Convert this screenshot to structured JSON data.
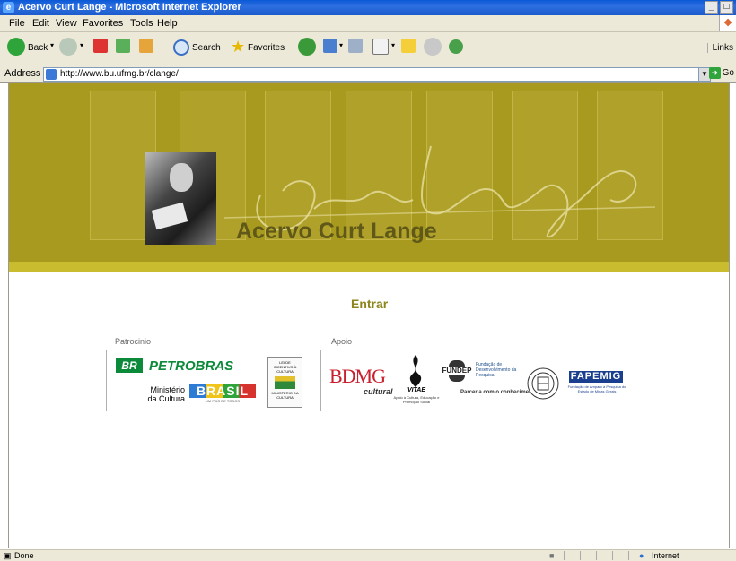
{
  "window": {
    "title": "Acervo Curt Lange - Microsoft Internet Explorer",
    "minimize": "_",
    "maximize": "□"
  },
  "menu": [
    "File",
    "Edit",
    "View",
    "Favorites",
    "Tools",
    "Help"
  ],
  "toolbar": {
    "back": "Back",
    "search": "Search",
    "favorites": "Favorites",
    "links": "Links"
  },
  "address": {
    "label": "Address",
    "url": "http://www.bu.ufmg.br/clange/",
    "go": "Go"
  },
  "page": {
    "banner_title": "Acervo Curt Lange",
    "enter_link": "Entrar",
    "sponsor_label": "Patrocinio",
    "support_label": "Apoio",
    "sponsors": {
      "petrobras": "PETROBRAS",
      "br": "BR",
      "ministerio": "Ministério\nda Cultura",
      "brasil": "BRASIL",
      "brasil_tag": "UM PAÍS DE TODOS",
      "lei": "LEI DE INCENTIVO À CULTURA",
      "lei_min": "MINISTÉRIO DA CULTURA"
    },
    "supporters": {
      "bdmg": "BDMG",
      "bdmg_sub": "cultural",
      "vitae": "VITAE",
      "vitae_sub": "Apoio à Cultura, Educação e Promoção Social",
      "fundep": "FUNDEP",
      "fundep_text": "Fundação de Desenvolvimento da Pesquisa",
      "fundep_tag": "Parceria com o conhecimento.",
      "fapemig": "FAPEMIG",
      "fapemig_sub": "Fundação de Amparo à Pesquisa do Estado de Minas Gerais"
    }
  },
  "status": {
    "text": "Done",
    "zone": "Internet"
  },
  "colors": {
    "banner": "#a79a1e",
    "banner_stripe": "#c9bc2e",
    "title": "#5f5818",
    "link": "#8d851b",
    "petrobras_green": "#0b8a3a",
    "bdmg_red": "#c8202e",
    "fapemig_blue": "#1a3f8e"
  },
  "icons": [
    "ie-icon",
    "back-icon",
    "forward-icon",
    "stop-icon",
    "refresh-icon",
    "home-icon",
    "search-icon",
    "favorites-icon",
    "history-icon",
    "mail-icon",
    "print-icon",
    "edit-icon",
    "folder-icon",
    "messenger-icon",
    "go-icon",
    "windows-logo-icon"
  ]
}
